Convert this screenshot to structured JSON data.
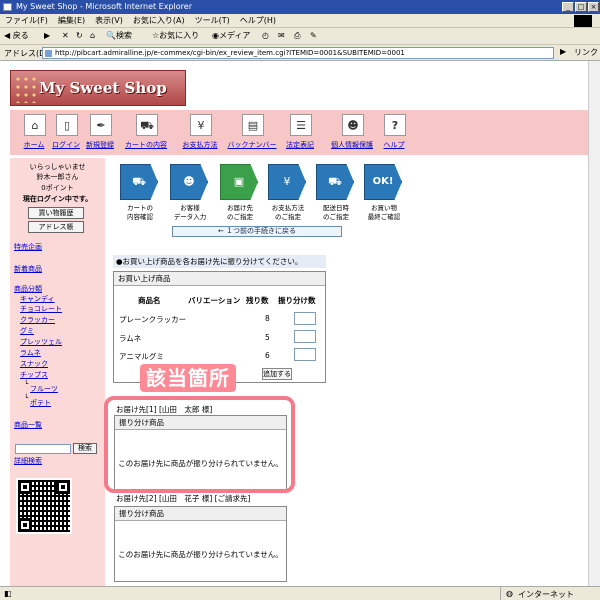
{
  "window": {
    "title": "My Sweet Shop - Microsoft Internet Explorer"
  },
  "menu": [
    "ファイル(F)",
    "編集(E)",
    "表示(V)",
    "お気に入り(A)",
    "ツール(T)",
    "ヘルプ(H)"
  ],
  "toolbar": {
    "back": "戻る",
    "search": "検索",
    "favorites": "お気に入り",
    "media": "メディア"
  },
  "address": {
    "label": "アドレス(D)",
    "url": "http://pibcart.admiralline.jp/e-commex/cgi-bin/ex_review_item.cgi?ITEMID=0001&SUBITEMID=0001",
    "go": "移動",
    "links": "リンク"
  },
  "shop": {
    "name": "My Sweet Shop"
  },
  "nav": [
    "ホーム",
    "ログイン",
    "新規登録",
    "カートの内容",
    "お支払方法",
    "バックナンバー",
    "法定表記",
    "個人情報保護",
    "ヘルプ"
  ],
  "sidebar": {
    "welcome": "いらっしゃいませ",
    "user": "鈴木一郎さん",
    "points": "0ポイント",
    "status": "現在ログイン中です。",
    "history_btn": "買い物履歴",
    "address_btn": "アドレス帳",
    "special": "特売企画",
    "new": "新着商品",
    "category_title": "商品分類",
    "categories": [
      "キャンディ",
      "チョコレート",
      "クラッカー",
      "グミ",
      "プレッツェル",
      "ラムネ",
      "スナック",
      "チップス"
    ],
    "subcategories": [
      "フルーツ",
      "ポテト"
    ],
    "product_list": "商品一覧",
    "search_btn": "検索",
    "advanced_search": "詳細検索"
  },
  "steps": [
    {
      "label": "カートの\n内容確認",
      "icon": "cart-icon"
    },
    {
      "label": "お客様\nデータ入力",
      "icon": "person-icon"
    },
    {
      "label": "お届け先\nのご指定",
      "icon": "gift-icon"
    },
    {
      "label": "お支払方法\nのご指定",
      "icon": "card-icon"
    },
    {
      "label": "配送日時\nのご指定",
      "icon": "truck-icon"
    },
    {
      "label": "お買い物\n最終ご確認",
      "icon": "ok-icon"
    }
  ],
  "back_button": "← １つ前の手続きに戻る",
  "instruction": "●お買い上げ商品を各お届け先に振り分けてください。",
  "purchase_panel": {
    "title": "お買い上げ商品",
    "headers": [
      "商品名",
      "バリエーション",
      "残り数",
      "振り分け数"
    ],
    "rows": [
      {
        "name": "プレーンクラッカー",
        "remain": "8"
      },
      {
        "name": "ラムネ",
        "remain": "5"
      },
      {
        "name": "アニマルグミ",
        "remain": "6"
      }
    ],
    "add_button": "追加する"
  },
  "annotation": "該当箇所",
  "destinations": [
    {
      "title": "お届け先[1] [山田　太郎 様]",
      "panel_title": "振り分け商品",
      "message": "このお届け先に商品が振り分けられていません。"
    },
    {
      "title": "お届け先[2] [山田　花子 様] [ご請求先]",
      "panel_title": "振り分け商品",
      "message": "このお届け先に商品が振り分けられていません。"
    }
  ],
  "status": {
    "zone": "インターネット"
  },
  "colors": {
    "title_bar": "#2a4fa8",
    "nav_bg": "#f7c6c6",
    "sidebar_bg": "#fbd9d9",
    "step_blue": "#2b78b8",
    "step_active": "#3aa14a",
    "annotation": "#f37b8a"
  }
}
